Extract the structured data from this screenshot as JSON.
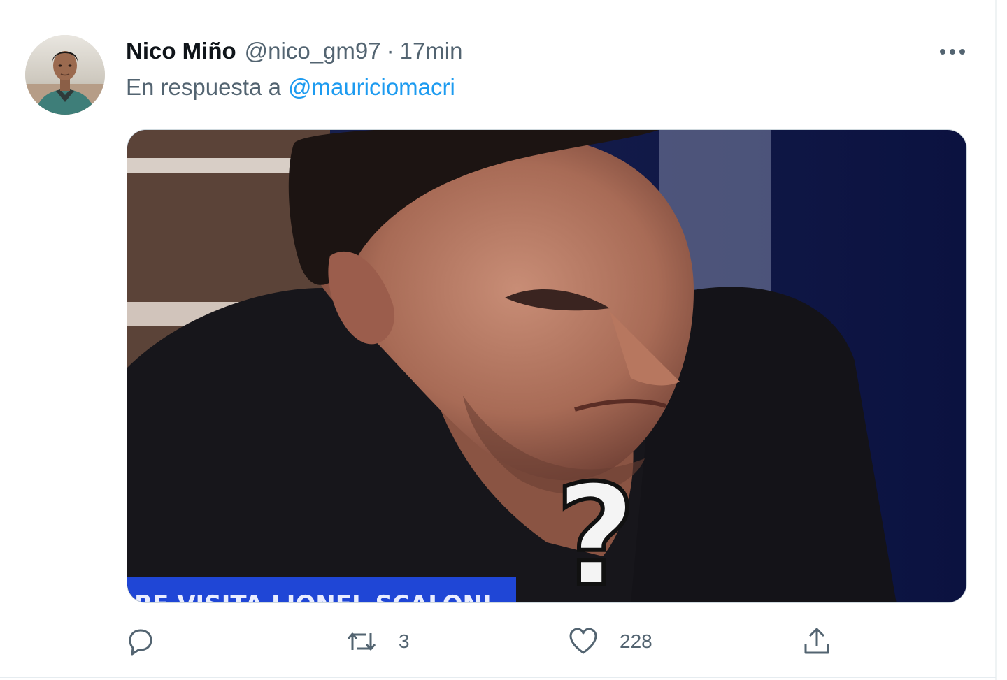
{
  "tweet": {
    "author": {
      "display_name": "Nico Miño",
      "handle": "@nico_gm97",
      "avatar_icon": "user-avatar-photo"
    },
    "separator": "·",
    "timestamp": "17min",
    "reply_to": {
      "prefix": "En respuesta a",
      "mention": "@mauriciomacri"
    },
    "media": {
      "kind": "image",
      "overlay_glyph": "?",
      "caption_banner": "RE VISITA LIONEL SCALONI"
    },
    "actions": {
      "reply": {
        "icon": "reply-bubble-icon",
        "count": ""
      },
      "retweet": {
        "icon": "retweet-icon",
        "count": "3"
      },
      "like": {
        "icon": "heart-icon",
        "count": "228"
      },
      "share": {
        "icon": "share-upload-icon",
        "count": ""
      }
    },
    "more_icon": "more-horizontal-icon"
  },
  "colors": {
    "accent": "#1d9bf0",
    "text_primary": "#0f1419",
    "text_secondary": "#536471"
  }
}
